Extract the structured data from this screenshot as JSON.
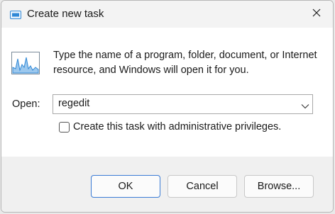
{
  "window": {
    "title": "Create new task",
    "title_icon": "run-dialog-icon",
    "close_icon": "close-icon"
  },
  "main": {
    "app_icon": "task-manager-graph-icon",
    "description": "Type the name of a program, folder, document, or Internet resource, and Windows will open it for you.",
    "open_label": "Open:",
    "open_value": "regedit",
    "checkbox_label": "Create this task with administrative privileges.",
    "checkbox_checked": false
  },
  "buttons": {
    "ok": "OK",
    "cancel": "Cancel",
    "browse": "Browse..."
  },
  "colors": {
    "accent": "#3a7bd5",
    "graph_blue": "#2f88d6"
  }
}
